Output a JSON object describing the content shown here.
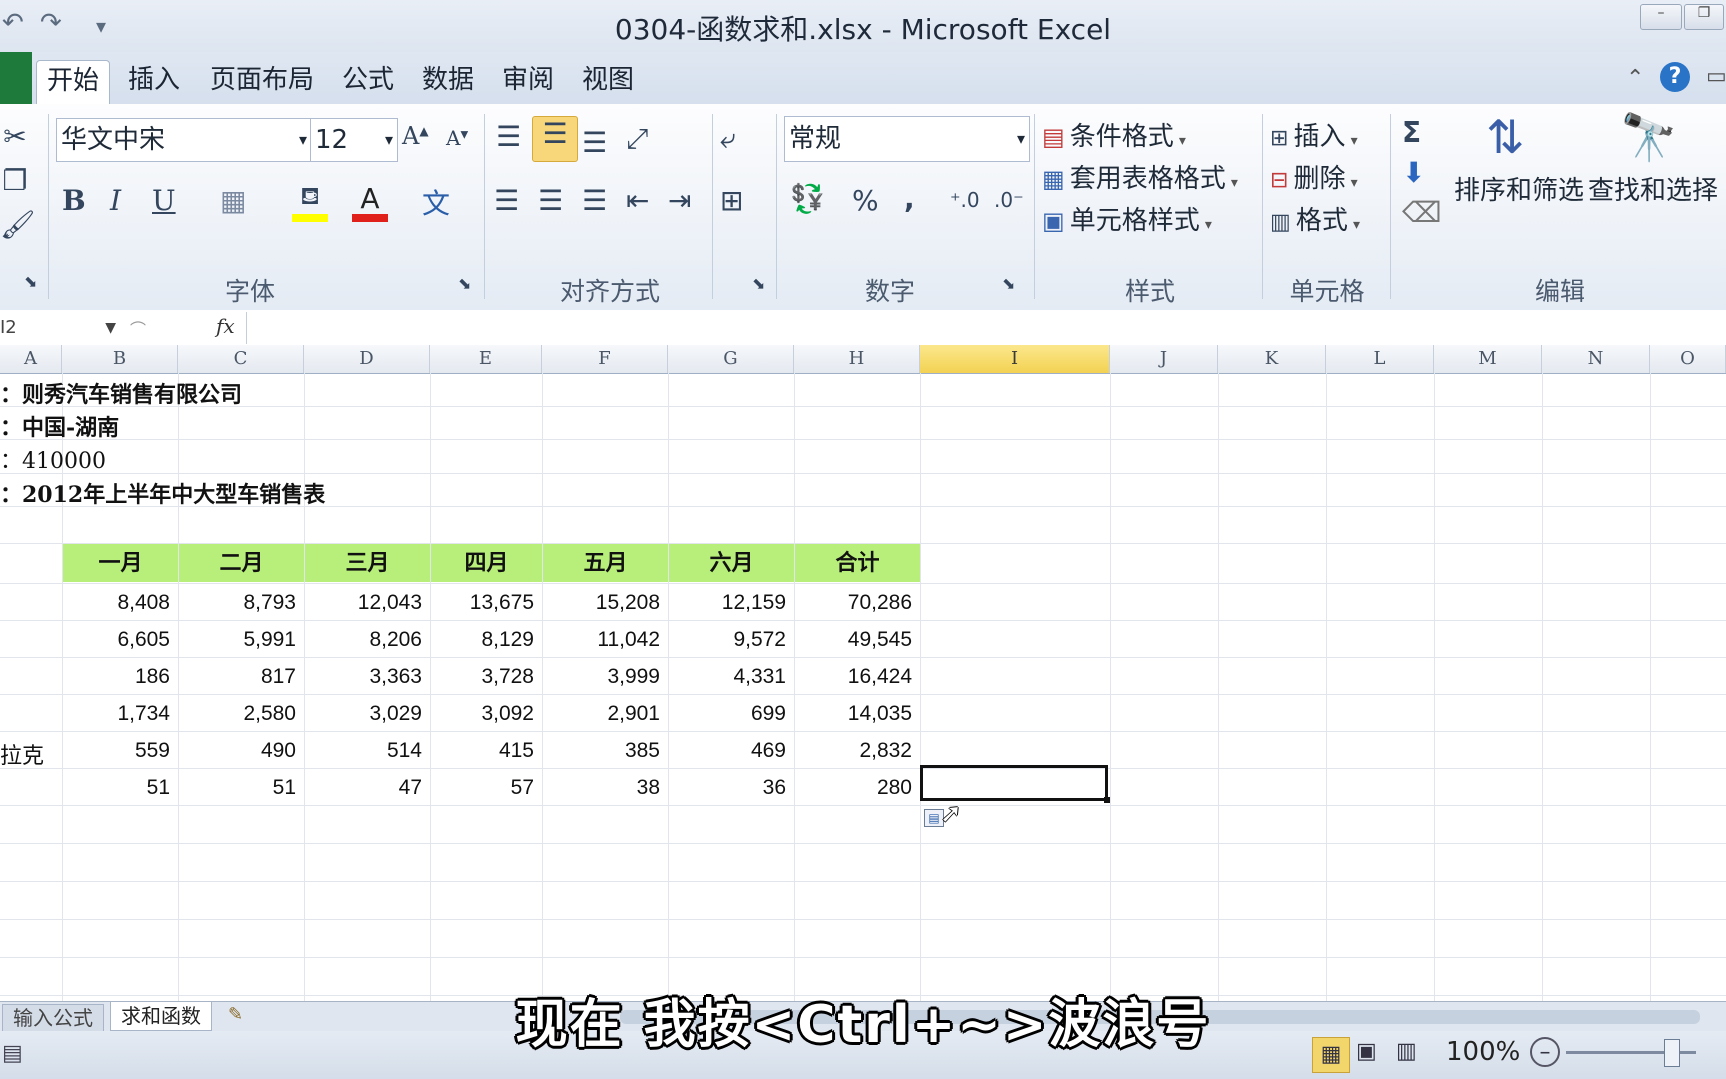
{
  "window": {
    "title": "0304-函数求和.xlsx - Microsoft Excel"
  },
  "tabs": [
    "开始",
    "插入",
    "页面布局",
    "公式",
    "数据",
    "审阅",
    "视图"
  ],
  "ribbon": {
    "font_name": "华文中宋",
    "font_size": "12",
    "number_format": "常规",
    "groups": {
      "font": "字体",
      "alignment": "对齐方式",
      "number": "数字",
      "styles": "样式",
      "cells": "单元格",
      "editing": "编辑"
    },
    "styles": {
      "conditional": "条件格式",
      "table": "套用表格格式",
      "cell_styles": "单元格样式"
    },
    "cells": {
      "insert": "插入",
      "delete": "删除",
      "format": "格式"
    },
    "editing": {
      "sort_filter": "排序和筛选",
      "find_select": "查找和选择"
    },
    "number_buttons": {
      "percent": "%",
      "comma": ","
    },
    "font_buttons": {
      "bold": "B",
      "italic": "I",
      "underline": "U"
    },
    "colors": {
      "fill": "#ffff00",
      "font_color": "#e0201b"
    }
  },
  "formula_bar": {
    "name_box": "I2",
    "fx": "fx",
    "value": ""
  },
  "columns": [
    "A",
    "B",
    "C",
    "D",
    "E",
    "F",
    "G",
    "H",
    "I",
    "J",
    "K",
    "L",
    "M",
    "N",
    "O"
  ],
  "selected_column": "I",
  "sheet": {
    "info_lines": [
      "：则秀汽车销售有限公司",
      "：中国-湖南",
      "：410000",
      "：2012年上半年中大型车销售表"
    ],
    "headers": [
      "一月",
      "二月",
      "三月",
      "四月",
      "五月",
      "六月",
      "合计"
    ],
    "rows": [
      {
        "label": "",
        "values": [
          "8,408",
          "8,793",
          "12,043",
          "13,675",
          "15,208",
          "12,159",
          "70,286"
        ]
      },
      {
        "label": "",
        "values": [
          "6,605",
          "5,991",
          "8,206",
          "8,129",
          "11,042",
          "9,572",
          "49,545"
        ]
      },
      {
        "label": "",
        "values": [
          "186",
          "817",
          "3,363",
          "3,728",
          "3,999",
          "4,331",
          "16,424"
        ]
      },
      {
        "label": "",
        "values": [
          "1,734",
          "2,580",
          "3,029",
          "3,092",
          "2,901",
          "699",
          "14,035"
        ]
      },
      {
        "label": "拉克",
        "values": [
          "559",
          "490",
          "514",
          "415",
          "385",
          "469",
          "2,832"
        ]
      },
      {
        "label": "",
        "values": [
          "51",
          "51",
          "47",
          "57",
          "38",
          "36",
          "280"
        ]
      }
    ],
    "header_fill": "#b8ee7a"
  },
  "sheet_tabs": [
    "输入公式",
    "求和函数"
  ],
  "status": {
    "zoom": "100%"
  },
  "subtitle": "现在 我按<Ctrl+~>波浪号"
}
